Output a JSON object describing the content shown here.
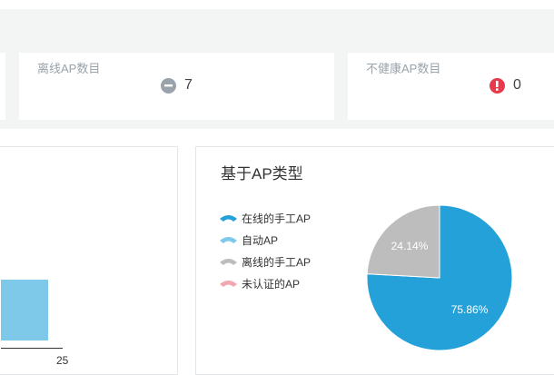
{
  "stats": {
    "offline": {
      "label": "离线AP数目",
      "value": "7",
      "icon": "minus-circle-icon",
      "color": "#9aa3ab"
    },
    "unhealthy": {
      "label": "不健康AP数目",
      "value": "0",
      "icon": "alert-circle-icon",
      "color": "#e8394d"
    }
  },
  "bar_panel": {
    "tick_label": "25",
    "bar_color": "#7ec8ea"
  },
  "pie_panel": {
    "title": "基于AP类型",
    "legend": [
      {
        "label": "在线的手工AP",
        "color": "#25a1d9"
      },
      {
        "label": "自动AP",
        "color": "#7ec8ea"
      },
      {
        "label": "离线的手工AP",
        "color": "#bdbdbd"
      },
      {
        "label": "未认证的AP",
        "color": "#f2a7b0"
      }
    ]
  },
  "chart_data": {
    "type": "pie",
    "title": "基于AP类型",
    "categories": [
      "在线的手工AP",
      "自动AP",
      "离线的手工AP",
      "未认证的AP"
    ],
    "values": [
      75.86,
      0,
      24.14,
      0
    ],
    "value_labels": [
      "75.86%",
      "",
      "24.14%",
      ""
    ],
    "colors": [
      "#25a1d9",
      "#7ec8ea",
      "#bdbdbd",
      "#f2a7b0"
    ],
    "legend_position": "left"
  }
}
